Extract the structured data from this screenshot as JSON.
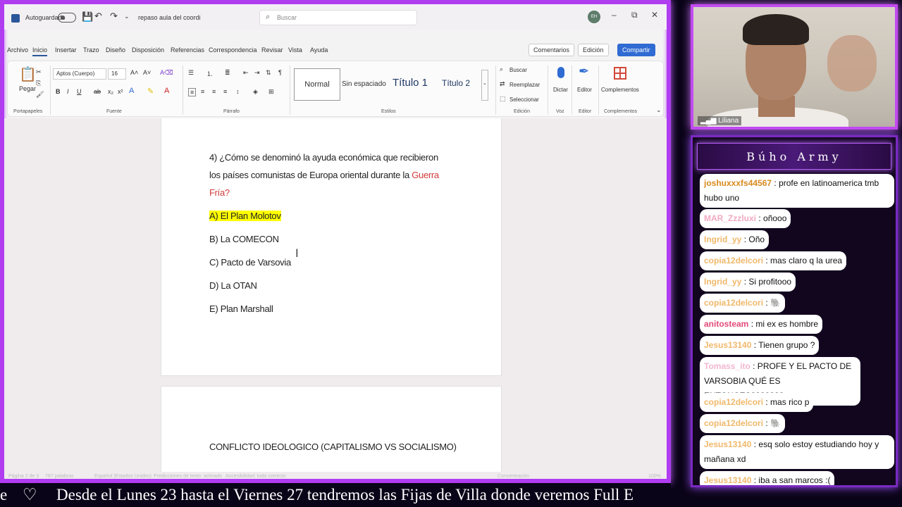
{
  "word": {
    "titlebar": {
      "autosave_label": "Autoguardado",
      "doc_title": "repaso aula del coordi",
      "search_placeholder": "Buscar",
      "avatar": "EH"
    },
    "menu_tabs": [
      "Archivo",
      "Inicio",
      "Insertar",
      "Trazo",
      "Diseño",
      "Disposición",
      "Referencias",
      "Correspondencia",
      "Revisar",
      "Vista",
      "Ayuda"
    ],
    "actions": {
      "comments": "Comentarios",
      "editing": "Edición",
      "share": "Compartir"
    },
    "ribbon": {
      "paste": "Pegar",
      "font_name": "Aptos (Cuerpo)",
      "font_size": "16",
      "styles": {
        "normal": "Normal",
        "no_spacing": "Sin espaciado",
        "heading1": "Título 1",
        "heading2": "Título 2"
      },
      "edit_find": "Buscar",
      "edit_replace": "Reemplazar",
      "edit_select": "Seleccionar",
      "dictate": "Dictar",
      "editor": "Editor",
      "addins": "Complementos",
      "groups": {
        "clipboard": "Portapapeles",
        "font": "Fuente",
        "paragraph": "Párrafo",
        "styles": "Estilos",
        "editing": "Edición",
        "voice": "Voz",
        "editor": "Editor",
        "addins": "Complementos"
      }
    },
    "document": {
      "question_line1": "4) ¿Cómo se denominó la ayuda económica que recibieron",
      "question_line2_a": "los países comunistas de Europa oriental durante la ",
      "question_line2_b": "Guerra",
      "question_line3": "Fría?",
      "options": [
        "A) El Plan Molotov",
        "B) La COMECON",
        "C) Pacto de Varsovia",
        "D) La OTAN",
        "E) Plan Marshall"
      ],
      "page2_heading": "CONFLICTO IDEOLOGICO (CAPITALISMO VS SOCIALISMO)"
    },
    "statusbar": {
      "page": "Página 2 de 3",
      "words": "787 palabras",
      "language": "Español (Estados Unidos)",
      "predictions": "Predicciones de texto: activado",
      "accessibility": "Accesibilidad: todo correcto",
      "focus": "Concentración",
      "zoom": "100%"
    }
  },
  "camera": {
    "label": "Liliana"
  },
  "chat": {
    "title": "Búho Army",
    "messages": [
      {
        "user": "joshuxxxfs44567",
        "text": ": profe en latinoamerica tmb hubo uno",
        "color": "#d98a1f"
      },
      {
        "user": "MAR_Zzzluxi",
        "text": ": oñooo",
        "color": "#f2a9c2"
      },
      {
        "user": "Ingrid_yy",
        "text": ": Oño",
        "color": "#f0b86a"
      },
      {
        "user": "copia12delcori",
        "text": ": mas claro q la urea",
        "color": "#f0b86a"
      },
      {
        "user": "Ingrid_yy",
        "text": ": Si profitooo",
        "color": "#f0b86a"
      },
      {
        "user": "copia12delcori",
        "text": ": 🐘",
        "color": "#f0b86a"
      },
      {
        "user": "anitosteam",
        "text": ": mi ex es hombre",
        "color": "#e24a7a"
      },
      {
        "user": "Jesus13140",
        "text": ": Tienen grupo ?",
        "color": "#f0b86a"
      },
      {
        "user": "Tomass_ito",
        "text": ": PROFE Y EL PACTO DE VARSOBIA QUÉ ES ENTONCES???????",
        "color": "#f2b6cf"
      },
      {
        "user": "copia12delcori",
        "text": ": mas rico p",
        "color": "#f0b86a"
      },
      {
        "user": "copia12delcori",
        "text": ": 🐘",
        "color": "#f0b86a"
      },
      {
        "user": "Jesus13140",
        "text": ": esq solo estoy estudiando hoy y mañana xd",
        "color": "#f0b86a"
      },
      {
        "user": "Jesus13140",
        "text": ": iba a san marcos :(",
        "color": "#f0b86a"
      }
    ]
  },
  "ticker": {
    "prefix": "e",
    "heart": "♡",
    "text": "Desde el Lunes 23 hasta el Viernes 27 tendremos las Fijas de Villa donde veremos Full E"
  }
}
